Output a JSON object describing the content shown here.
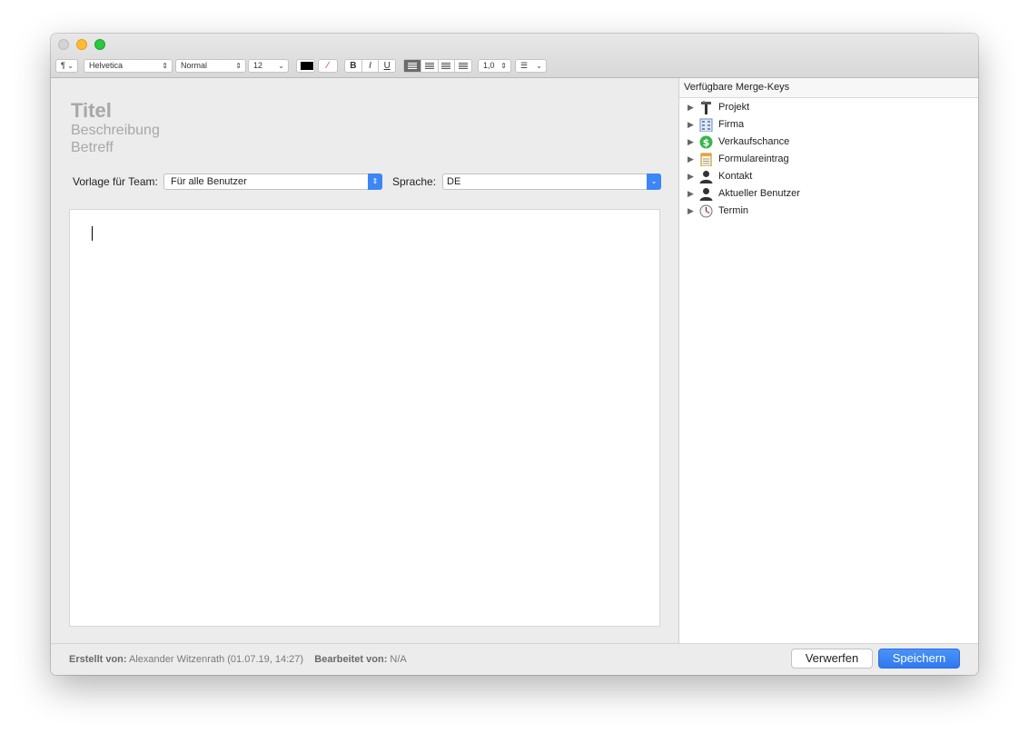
{
  "toolbar": {
    "paragraph": "¶",
    "font": "Helvetica",
    "style": "Normal",
    "size": "12",
    "bold": "B",
    "italic": "I",
    "underline": "U",
    "line_spacing": "1,0",
    "list": "☰"
  },
  "form": {
    "title_placeholder": "Titel",
    "description_placeholder": "Beschreibung",
    "subject_placeholder": "Betreff",
    "team_label": "Vorlage für Team:",
    "team_value": "Für alle Benutzer",
    "language_label": "Sprache:",
    "language_value": "DE"
  },
  "merge_keys": {
    "header": "Verfügbare Merge-Keys",
    "items": [
      {
        "label": "Projekt",
        "icon": "project-icon"
      },
      {
        "label": "Firma",
        "icon": "company-icon"
      },
      {
        "label": "Verkaufschance",
        "icon": "dollar-icon"
      },
      {
        "label": "Formulareintrag",
        "icon": "form-icon"
      },
      {
        "label": "Kontakt",
        "icon": "person-icon"
      },
      {
        "label": "Aktueller Benutzer",
        "icon": "person-icon"
      },
      {
        "label": "Termin",
        "icon": "clock-icon"
      }
    ]
  },
  "footer": {
    "created_label": "Erstellt von:",
    "created_value": "Alexander Witzenrath (01.07.19, 14:27)",
    "edited_label": "Bearbeitet von:",
    "edited_value": "N/A",
    "discard": "Verwerfen",
    "save": "Speichern"
  },
  "colors": {
    "accent": "#2f78f0",
    "placeholder": "#a8a8a8",
    "window_bg": "#ececec"
  }
}
